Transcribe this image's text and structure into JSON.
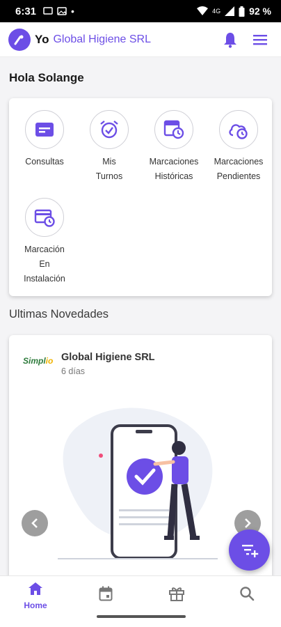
{
  "status_bar": {
    "time": "6:31",
    "network": "4G",
    "battery": "92 %"
  },
  "app_bar": {
    "brand_short": "Yo",
    "company": "Global Higiene SRL"
  },
  "greeting": "Hola Solange",
  "shortcuts": [
    {
      "label": "Consultas",
      "icon": "card-icon"
    },
    {
      "label": "Mis Turnos",
      "icon": "alarm-clock-icon"
    },
    {
      "label": "Marcaciones Históricas",
      "icon": "history-calendar-icon"
    },
    {
      "label": "Marcaciones Pendientes",
      "icon": "cloud-clock-icon"
    },
    {
      "label": "Marcación En Instalación",
      "icon": "card-clock-icon"
    }
  ],
  "section_title": "Ultimas Novedades",
  "news": {
    "logo_text": "Simpl",
    "logo_text_accent": "io",
    "company": "Global Higiene SRL",
    "age": "6 días"
  },
  "bottom_nav": {
    "home_label": "Home"
  },
  "colors": {
    "accent": "#6c4ee6",
    "background": "#f4f4f6"
  }
}
